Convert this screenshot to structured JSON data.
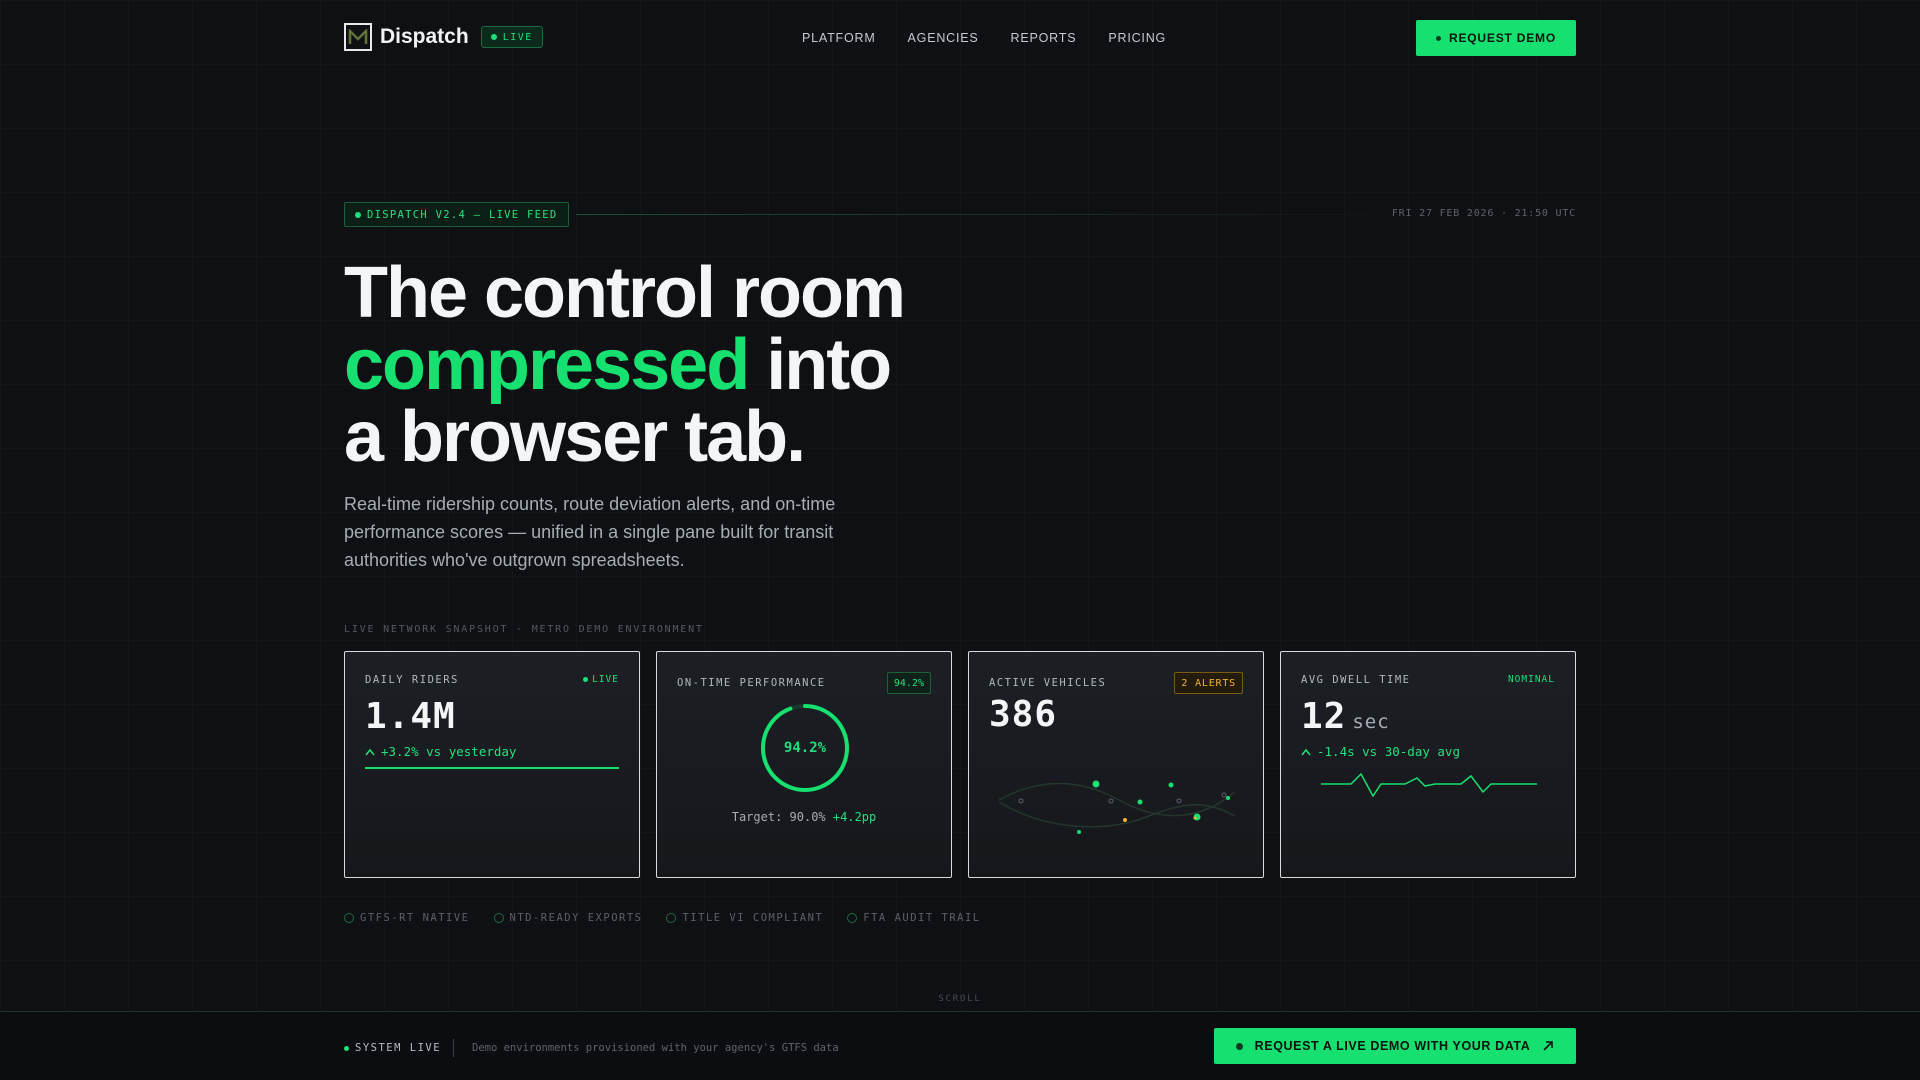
{
  "nav": {
    "brand": "Dispatch",
    "live_badge": "LIVE",
    "links": [
      "PLATFORM",
      "AGENCIES",
      "REPORTS",
      "PRICING"
    ],
    "cta": "REQUEST DEMO"
  },
  "version": {
    "badge": "DISPATCH V2.4 — LIVE FEED",
    "timestamp": "FRI 27 FEB 2026 · 21:50 UTC"
  },
  "hero": {
    "line1": "The control room",
    "accent": "compressed",
    "line2_rest": " into",
    "line3": "a browser tab.",
    "subtitle": "Real-time ridership counts, route deviation alerts, and on-time performance scores — unified in a single pane built for transit authorities who've outgrown spreadsheets."
  },
  "snapshot_label": "LIVE NETWORK SNAPSHOT · METRO DEMO ENVIRONMENT",
  "cards": {
    "riders": {
      "label": "DAILY RIDERS",
      "tag": "LIVE",
      "value": "1.4M",
      "delta": "+3.2% vs yesterday"
    },
    "otp": {
      "label": "ON-TIME PERFORMANCE",
      "tag": "94.2%",
      "value": "94.2%",
      "progress": 0.942,
      "target_text": "Target: 90.0%",
      "target_delta": "+4.2pp"
    },
    "vehicles": {
      "label": "ACTIVE VEHICLES",
      "tag": "2 ALERTS",
      "value": "386"
    },
    "dwell": {
      "label": "AVG DWELL TIME",
      "tag": "NOMINAL",
      "value": "12",
      "unit": "sec",
      "delta": "-1.4s vs 30-day avg"
    }
  },
  "compliance": [
    "GTFS-RT NATIVE",
    "NTD-READY EXPORTS",
    "TITLE VI COMPLIANT",
    "FTA AUDIT TRAIL"
  ],
  "scroll": "SCROLL",
  "footer": {
    "status": "SYSTEM LIVE",
    "note": "Demo environments provisioned with your agency's GTFS data",
    "cta": "REQUEST A LIVE DEMO WITH YOUR DATA"
  },
  "colors": {
    "accent": "#16e06f",
    "warning": "#f0b429",
    "background": "#0e1013"
  },
  "icons": [
    "logo-icon",
    "live-dot-icon",
    "arrow-up-icon",
    "arrow-up-right-icon",
    "ring-icon"
  ]
}
